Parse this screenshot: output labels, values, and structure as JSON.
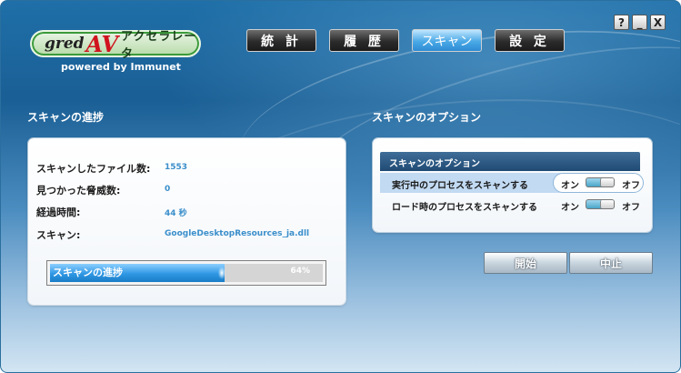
{
  "logo": {
    "brand_gred": "gred",
    "brand_av": "AV",
    "brand_kana": "アクセラレータ",
    "powered_by": "powered by Immunet"
  },
  "tabs": [
    {
      "label": "統 計",
      "active": false
    },
    {
      "label": "履 歴",
      "active": false
    },
    {
      "label": "スキャン",
      "active": true
    },
    {
      "label": "設 定",
      "active": false
    }
  ],
  "window_controls": {
    "help": "?",
    "minimize": "_",
    "close": "X"
  },
  "scan_progress": {
    "section_title": "スキャンの進捗",
    "rows": [
      {
        "label": "スキャンしたファイル数:",
        "value": "1553"
      },
      {
        "label": "見つかった脅威数:",
        "value": "0"
      },
      {
        "label": "経過時間:",
        "value": "44 秒"
      },
      {
        "label": "スキャン:",
        "value": "GoogleDesktopResources_ja.dll"
      }
    ],
    "bar": {
      "label": "スキャンの進捗",
      "percent_text": "64%",
      "fraction": 0.64
    }
  },
  "scan_options": {
    "section_title": "スキャンのオプション",
    "header": "スキャンのオプション",
    "options": [
      {
        "label": "実行中のプロセスをスキャンする",
        "on": "オン",
        "off": "オフ",
        "state": "on",
        "highlighted": true
      },
      {
        "label": "ロード時のプロセスをスキャンする",
        "on": "オン",
        "off": "オフ",
        "state": "on",
        "highlighted": false
      }
    ]
  },
  "actions": {
    "start": "開始",
    "stop": "中止"
  },
  "colors": {
    "accent": "#2f97e4",
    "value_text": "#3b8fcb",
    "header_bar": "#2b5a85"
  }
}
